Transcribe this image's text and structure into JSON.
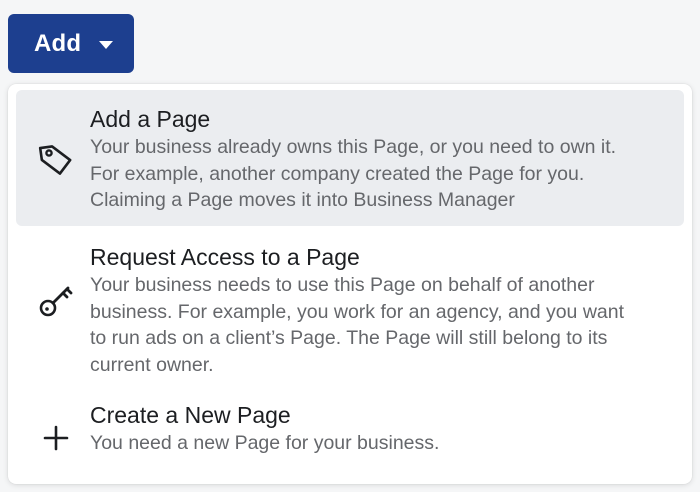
{
  "add_button": {
    "label": "Add",
    "icon": "caret-down-icon"
  },
  "menu": {
    "items": [
      {
        "icon": "tag-icon",
        "title": "Add a Page",
        "description_lines": [
          "Your business already owns this Page, or you need to own it.",
          "For example, another company created the Page for you.",
          "Claiming a Page moves it into Business Manager"
        ],
        "highlighted": true
      },
      {
        "icon": "key-icon",
        "title": "Request Access to a Page",
        "description_lines": [
          "Your business needs to use this Page on behalf of another",
          "business. For example, you work for an agency, and you want",
          "to run ads on a client’s Page. The Page will still belong to its",
          "current owner."
        ],
        "highlighted": false
      },
      {
        "icon": "plus-icon",
        "title": "Create a New Page",
        "description_lines": [
          "You need a new Page for your business."
        ],
        "highlighted": false
      }
    ]
  },
  "colors": {
    "button_bg": "#1d3f8f",
    "highlight_bg": "#ebedf0",
    "title_text": "#1c1e21",
    "desc_text": "#65676b"
  }
}
